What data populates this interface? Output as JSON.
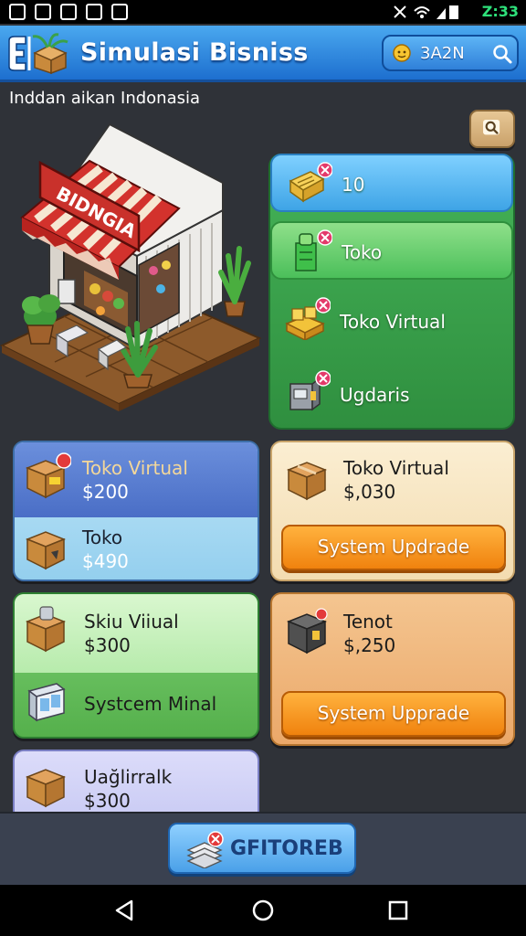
{
  "status_bar": {
    "time": "Z:33"
  },
  "header": {
    "title": "Simulasi Bisniss",
    "user_name": "3A2N"
  },
  "subtitle": "Inddan aikan Indonasia",
  "shop": {
    "sign": "BIDNGIA"
  },
  "categories": [
    {
      "label": "10"
    },
    {
      "label": "Toko"
    },
    {
      "label": "Toko Virtual"
    },
    {
      "label": "Ugdaris"
    }
  ],
  "cards": {
    "card1": {
      "top_name": "Toko Virtual",
      "top_price": "$200",
      "bottom_name": "Toko",
      "bottom_price": "$490"
    },
    "card2": {
      "name": "Toko Virtual",
      "price": "$,030",
      "button": "System Updrade"
    },
    "card3": {
      "top_name": "Skiu Viiual",
      "top_price": "$300",
      "bottom_name": "Systcem Minal"
    },
    "card4": {
      "name": "Tenot",
      "price": "$,250",
      "button": "System Upprade"
    },
    "card5": {
      "name": "Uağlirralk",
      "price": "$300"
    }
  },
  "bottom_button": {
    "label": "GFITOREB"
  },
  "colors": {
    "header_blue": "#2f86dc",
    "accent_orange": "#f59a22",
    "panel_green": "#3aa44c",
    "background": "#2f3238"
  }
}
